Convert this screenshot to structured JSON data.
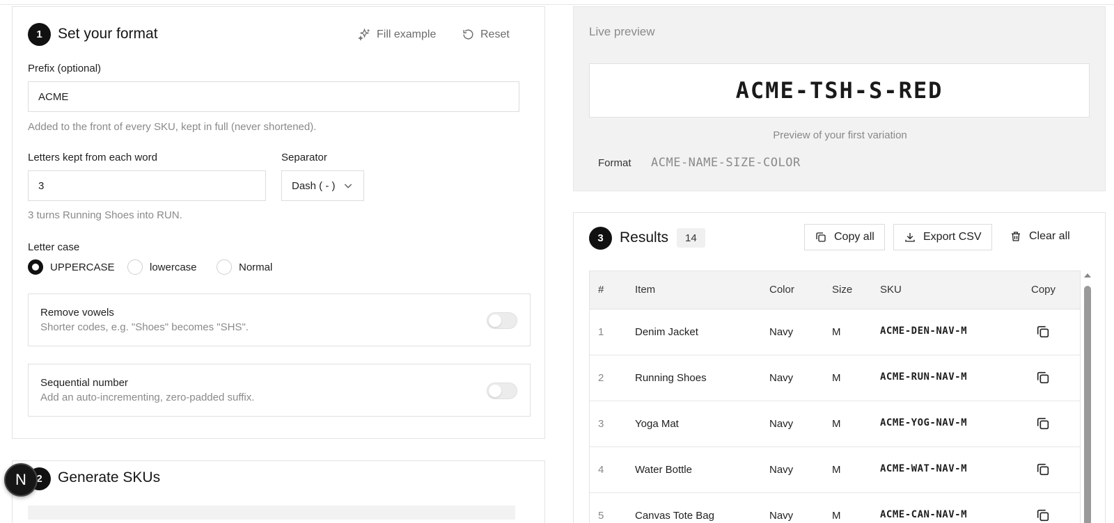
{
  "format_section": {
    "step": "1",
    "title": "Set your format",
    "fill_example": "Fill example",
    "reset": "Reset",
    "prefix_label": "Prefix (optional)",
    "prefix_value": "ACME",
    "prefix_hint": "Added to the front of every SKU, kept in full (never shortened).",
    "letters_label": "Letters kept from each word",
    "letters_value": "3",
    "letters_hint": "3 turns Running Shoes into RUN.",
    "separator_label": "Separator",
    "separator_value": "Dash ( - )",
    "case_label": "Letter case",
    "case_options": [
      "UPPERCASE",
      "lowercase",
      "Normal"
    ],
    "case_selected": "UPPERCASE",
    "remove_vowels_title": "Remove vowels",
    "remove_vowels_desc": "Shorter codes, e.g. \"Shoes\" becomes \"SHS\".",
    "remove_vowels_on": false,
    "sequential_title": "Sequential number",
    "sequential_desc": "Add an auto-incrementing, zero-padded suffix.",
    "sequential_on": false
  },
  "generate_section": {
    "step": "2",
    "title": "Generate SKUs"
  },
  "preview": {
    "title": "Live preview",
    "sku": "ACME-TSH-S-RED",
    "caption": "Preview of your first variation",
    "format_label": "Format",
    "format_value": "ACME-NAME-SIZE-COLOR"
  },
  "results": {
    "step": "3",
    "title": "Results",
    "count": "14",
    "copy_all": "Copy all",
    "export_csv": "Export CSV",
    "clear_all": "Clear all",
    "columns": [
      "#",
      "Item",
      "Color",
      "Size",
      "SKU",
      "Copy"
    ],
    "rows": [
      {
        "num": "1",
        "item": "Denim Jacket",
        "color": "Navy",
        "size": "M",
        "sku": "ACME-DEN-NAV-M"
      },
      {
        "num": "2",
        "item": "Running Shoes",
        "color": "Navy",
        "size": "M",
        "sku": "ACME-RUN-NAV-M"
      },
      {
        "num": "3",
        "item": "Yoga Mat",
        "color": "Navy",
        "size": "M",
        "sku": "ACME-YOG-NAV-M"
      },
      {
        "num": "4",
        "item": "Water Bottle",
        "color": "Navy",
        "size": "M",
        "sku": "ACME-WAT-NAV-M"
      },
      {
        "num": "5",
        "item": "Canvas Tote Bag",
        "color": "Navy",
        "size": "M",
        "sku": "ACME-CAN-NAV-M"
      }
    ]
  },
  "floating_badge": "N",
  "icons": {
    "fill_example": "sparkle-icon",
    "reset": "reset-icon",
    "separator": "chevron-down-icon",
    "copy_all": "copy-icon",
    "export_csv": "download-icon",
    "clear_all": "trash-icon",
    "row_copy": "copy-icon"
  },
  "colors": {
    "accent": "#111111",
    "preview_bg": "#f2f2f2"
  }
}
